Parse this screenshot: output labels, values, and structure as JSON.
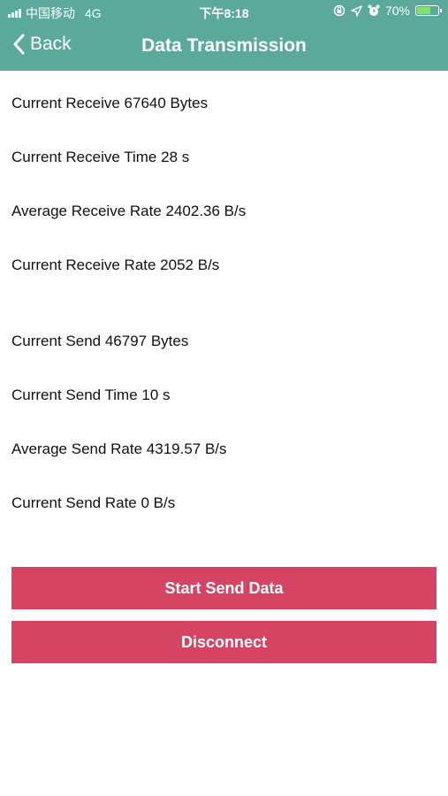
{
  "status_bar": {
    "carrier": "中国移动",
    "network": "4G",
    "time": "下午8:18",
    "battery_percent": "70%",
    "battery_level": 0.7,
    "icons": [
      "lock-rotation-icon",
      "location-arrow-icon",
      "alarm-clock-icon",
      "battery-icon"
    ]
  },
  "nav": {
    "back_label": "Back",
    "title": "Data Transmission"
  },
  "receive": {
    "current_bytes": "Current Receive 67640 Bytes",
    "current_time": "Current Receive Time 28 s",
    "average_rate": "Average Receive Rate 2402.36 B/s",
    "current_rate": "Current Receive Rate 2052 B/s"
  },
  "send": {
    "current_bytes": "Current Send 46797 Bytes",
    "current_time": "Current Send Time 10 s",
    "average_rate": "Average Send Rate 4319.57 B/s",
    "current_rate": "Current Send Rate 0 B/s"
  },
  "buttons": {
    "start_send": "Start Send Data",
    "disconnect": "Disconnect"
  },
  "colors": {
    "header": "#5aa99a",
    "button": "#d54563",
    "battery_fill": "#7ee36c"
  }
}
